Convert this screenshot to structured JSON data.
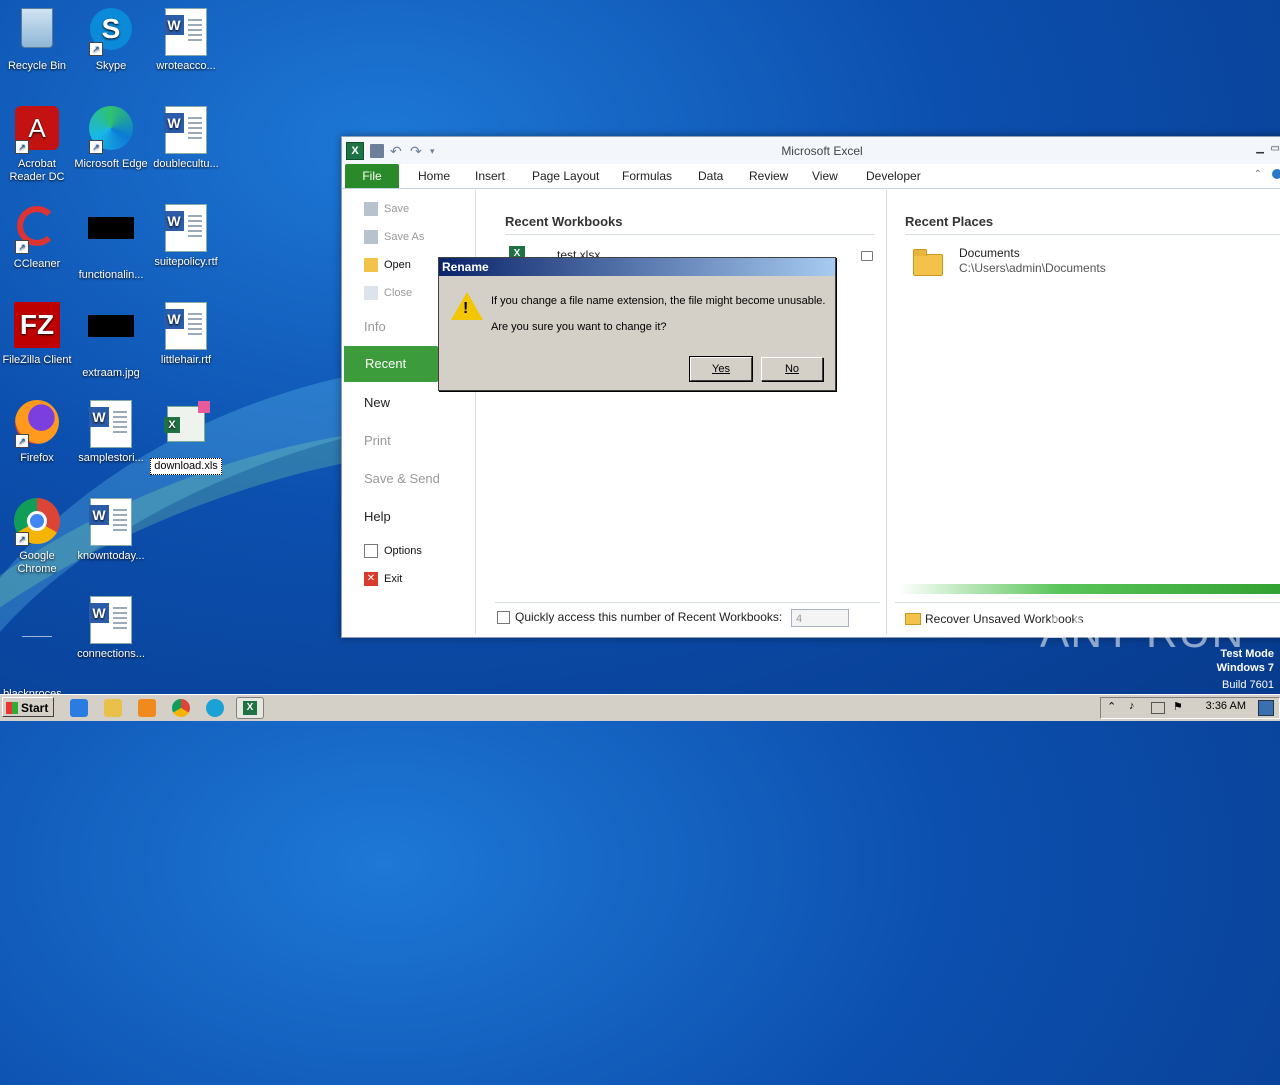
{
  "desktop": {
    "icons": [
      {
        "label": "Recycle Bin"
      },
      {
        "label": "Skype"
      },
      {
        "label": "wroteacco..."
      },
      {
        "label": "Acrobat Reader DC"
      },
      {
        "label": "Microsoft Edge"
      },
      {
        "label": "doublecultu..."
      },
      {
        "label": "CCleaner"
      },
      {
        "label": "functionalin..."
      },
      {
        "label": "suitepolicy.rtf"
      },
      {
        "label": "FileZilla Client"
      },
      {
        "label": "extraam.jpg"
      },
      {
        "label": "littlehair.rtf"
      },
      {
        "label": "Firefox"
      },
      {
        "label": "samplestori..."
      },
      {
        "label": "download.xls"
      },
      {
        "label": "Google Chrome"
      },
      {
        "label": "knowntoday..."
      },
      {
        "label": "blackproces..."
      },
      {
        "label": "connections..."
      }
    ]
  },
  "excel": {
    "title": "Microsoft Excel",
    "tabs": [
      "File",
      "Home",
      "Insert",
      "Page Layout",
      "Formulas",
      "Data",
      "Review",
      "View",
      "Developer"
    ],
    "nav": {
      "save": "Save",
      "save_as": "Save As",
      "open": "Open",
      "close": "Close",
      "info": "Info",
      "recent": "Recent",
      "new": "New",
      "print": "Print",
      "save_send": "Save & Send",
      "help": "Help",
      "options": "Options",
      "exit": "Exit"
    },
    "recent_workbooks": {
      "heading": "Recent Workbooks",
      "items": [
        {
          "name": "test.xlsx"
        }
      ],
      "quick_access_label": "Quickly access this number of Recent Workbooks:",
      "quick_access_value": "4"
    },
    "recent_places": {
      "heading": "Recent Places",
      "items": [
        {
          "name": "Documents",
          "path": "C:\\Users\\admin\\Documents"
        }
      ],
      "recover_label": "Recover Unsaved Workbooks"
    }
  },
  "dialog": {
    "title": "Rename",
    "message1": "If you change a file name extension, the file might become unusable.",
    "message2": "Are you sure you want to change it?",
    "yes": "Yes",
    "no": "No"
  },
  "taskbar": {
    "start": "Start",
    "clock": "3:36 AM"
  },
  "watermark": {
    "line1": "Test Mode",
    "line2": "Windows 7",
    "line3": "Build 7601",
    "brand": "ANY RUN"
  }
}
